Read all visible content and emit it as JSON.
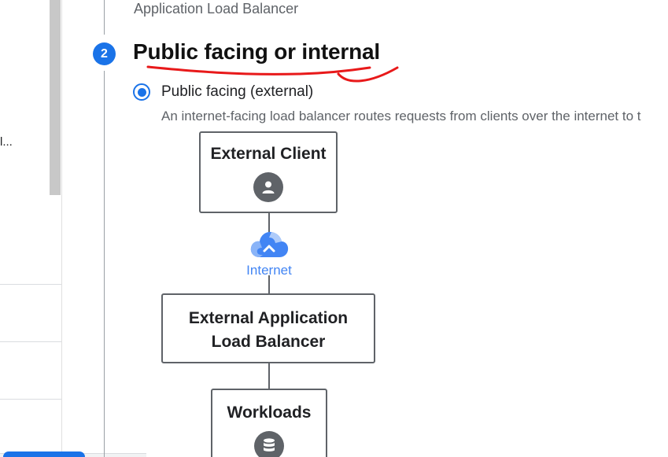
{
  "sidebar": {
    "truncated_text": "l..."
  },
  "steps": {
    "previous": {
      "title": "Application Load Balancer"
    },
    "current": {
      "number": "2",
      "title": "Public facing or internal"
    }
  },
  "option": {
    "label": "Public facing (external)",
    "selected": true,
    "description": "An internet-facing load balancer routes requests from clients over the internet to t"
  },
  "diagram": {
    "client": {
      "title": "External Client",
      "icon": "person-icon"
    },
    "internet": {
      "label": "Internet",
      "icon": "cloud-icon"
    },
    "load_balancer": {
      "title_line1": "External Application",
      "title_line2": "Load Balancer"
    },
    "workloads": {
      "title": "Workloads",
      "icon": "database-icon"
    }
  },
  "colors": {
    "accent": "#1a73e8",
    "annotation": "#e8191a",
    "node_border": "#5f6368",
    "internet_text": "#4285f4"
  }
}
